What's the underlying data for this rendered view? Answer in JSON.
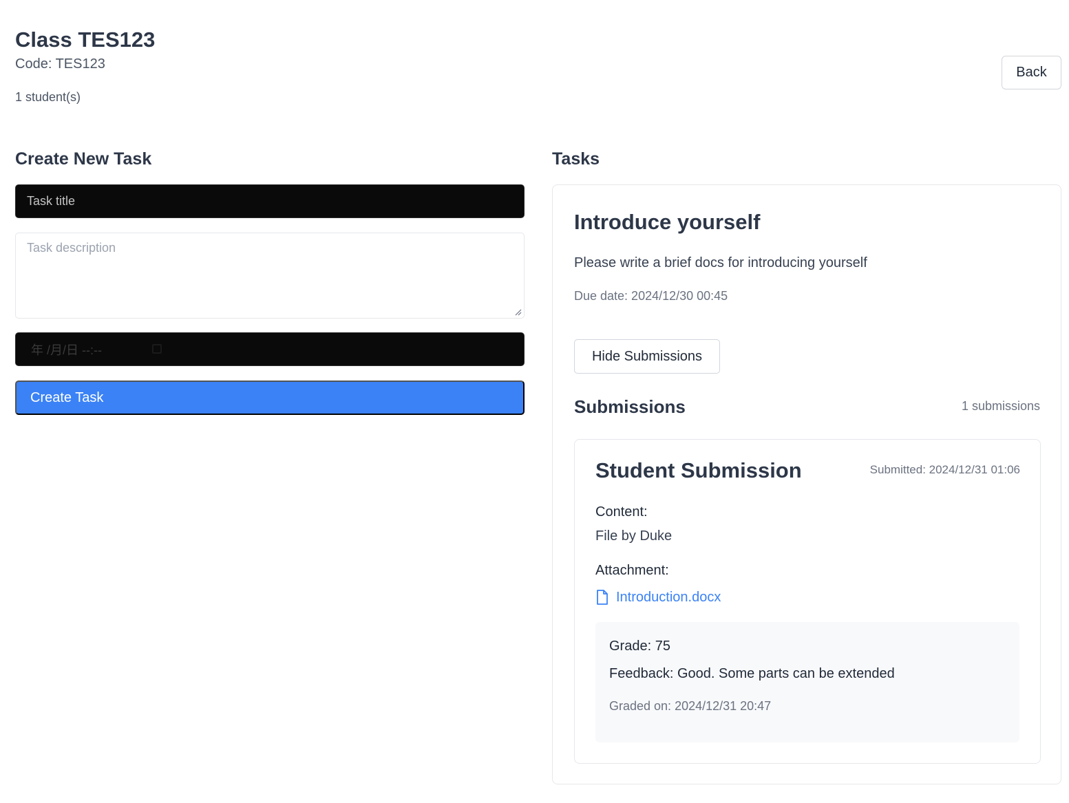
{
  "header": {
    "title": "Class TES123",
    "code": "Code: TES123",
    "student_count": "1 student(s)",
    "back_label": "Back"
  },
  "create_task": {
    "heading": "Create New Task",
    "title_placeholder": "Task title",
    "description_placeholder": "Task description",
    "date_placeholder": "年 /月/日 --:--",
    "submit_label": "Create Task"
  },
  "tasks": {
    "heading": "Tasks",
    "items": [
      {
        "title": "Introduce yourself",
        "description": "Please write a brief docs for introducing yourself",
        "due": "Due date: 2024/12/30 00:45",
        "toggle_label": "Hide Submissions",
        "submissions_heading": "Submissions",
        "submissions_count": "1 submissions",
        "submissions": [
          {
            "title": "Student Submission",
            "submitted": "Submitted: 2024/12/31 01:06",
            "content_label": "Content:",
            "content": "File by Duke",
            "attachment_label": "Attachment:",
            "attachment_name": "Introduction.docx",
            "attachment_icon": "file-icon",
            "grade": "Grade: 75",
            "feedback": "Feedback: Good. Some parts can be extended",
            "graded_on": "Graded on: 2024/12/31 20:47"
          }
        ]
      }
    ]
  },
  "colors": {
    "primary": "#3b82f6",
    "dark_input": "#0a0a0a",
    "heading": "#2d3748",
    "muted": "#6b7280",
    "grade_bg": "#f8f9fb"
  }
}
